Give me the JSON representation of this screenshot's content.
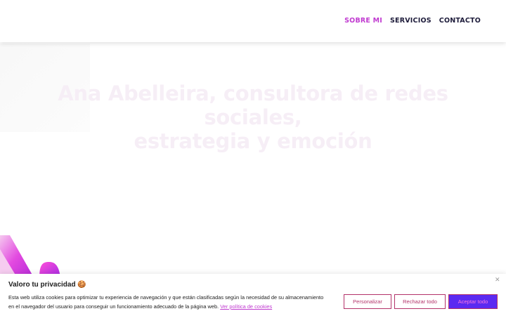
{
  "nav": {
    "items": [
      {
        "label": "SOBRE MI",
        "active": true
      },
      {
        "label": "SERVICIOS",
        "active": false
      },
      {
        "label": "CONTACTO",
        "active": false
      }
    ]
  },
  "hero": {
    "title_line1": "Ana Abelleira, consultora de redes sociales,",
    "title_line2": "estrategia y emoción"
  },
  "cookie": {
    "title": "Valoro tu privacidad",
    "title_emoji": "🍪",
    "text": "Esta web utiliza cookies para optimizar tu experiencia de navegación y que están clasificadas según la necesidad de su almacenamiento en el navegador del usuario para conseguir un funcionamiento adecuado de la página web.",
    "policy_link": "Ver política de cookies",
    "close_icon": "✕",
    "buttons": {
      "customize": "Personalizar",
      "reject": "Rechazar todo",
      "accept": "Aceptar todo"
    }
  },
  "colors": {
    "accent": "#c03ad0",
    "nav_text": "#1d1b3a",
    "button_border": "#b3336a",
    "accept_bg": "#5b2af1"
  }
}
